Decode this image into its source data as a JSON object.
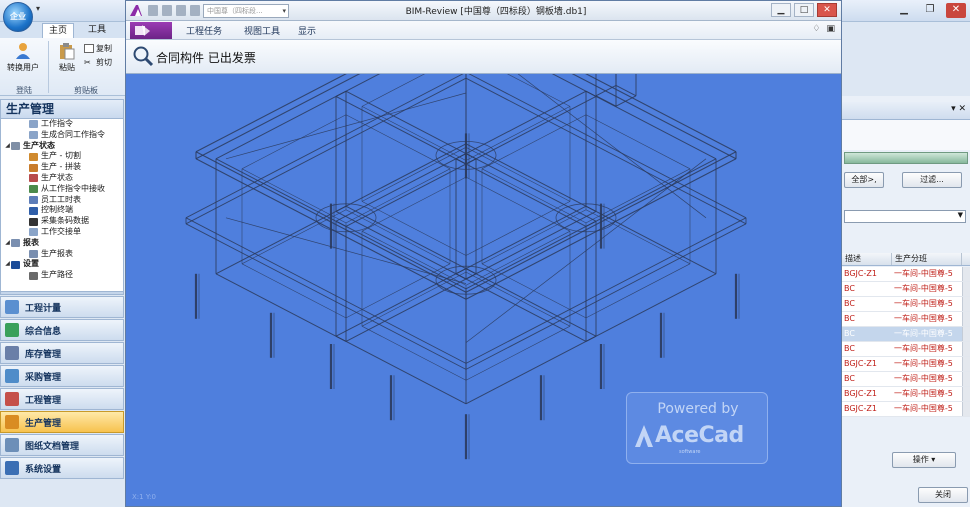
{
  "host": {
    "orb_label": "企业",
    "ribbon_tabs": [
      {
        "label": "主页",
        "active": true
      },
      {
        "label": "工具",
        "active": false
      }
    ],
    "ribbon": {
      "switch_user_label": "转换用户",
      "paste_label": "粘贴",
      "copy_label": "复制",
      "cut_label": "剪切",
      "group_login": "登陆",
      "group_clipboard": "剪贴板"
    },
    "nav_title": "生产管理",
    "tree": [
      {
        "label": "工作指令",
        "level": 2,
        "icon": "document-icon"
      },
      {
        "label": "生成合同工作指令",
        "level": 2,
        "icon": "document-icon"
      },
      {
        "label": "生产状态",
        "level": 1,
        "icon": "gears-icon",
        "category": true
      },
      {
        "label": "生产 - 切割",
        "level": 2,
        "icon": "cut-icon"
      },
      {
        "label": "生产 - 拼装",
        "level": 2,
        "icon": "assemble-icon"
      },
      {
        "label": "生产状态",
        "level": 2,
        "icon": "status-icon"
      },
      {
        "label": "从工作指令中接收",
        "level": 2,
        "icon": "receive-icon"
      },
      {
        "label": "员工工时表",
        "level": 2,
        "icon": "timesheet-icon"
      },
      {
        "label": "控制终端",
        "level": 2,
        "icon": "terminal-icon"
      },
      {
        "label": "采集条码数据",
        "level": 2,
        "icon": "barcode-icon"
      },
      {
        "label": "工作交接单",
        "level": 2,
        "icon": "document-icon"
      },
      {
        "label": "报表",
        "level": 1,
        "icon": "report-icon",
        "category": true
      },
      {
        "label": "生产报表",
        "level": 2,
        "icon": "report-icon"
      },
      {
        "label": "设置",
        "level": 1,
        "icon": "info-icon",
        "category": true
      },
      {
        "label": "生产路径",
        "level": 2,
        "icon": "path-icon"
      }
    ],
    "nav_buttons": [
      {
        "label": "工程计量",
        "active": false,
        "color": "#5a8fd0"
      },
      {
        "label": "综合信息",
        "active": false,
        "color": "#3aa05b"
      },
      {
        "label": "库存管理",
        "active": false,
        "color": "#6a7fa8"
      },
      {
        "label": "采购管理",
        "active": false,
        "color": "#4f8cc9"
      },
      {
        "label": "工程管理",
        "active": false,
        "color": "#c5504a"
      },
      {
        "label": "生产管理",
        "active": true,
        "color": "#d98c22"
      },
      {
        "label": "图纸文档管理",
        "active": false,
        "color": "#6d8fb8"
      },
      {
        "label": "系统设置",
        "active": false,
        "color": "#3b6fb4"
      }
    ],
    "right_panel": {
      "all_button": "全部>,",
      "filter_button": "过滤...",
      "column_desc": "描述",
      "column_team": "生产分班",
      "rows": [
        {
          "desc": "BGJC-Z1",
          "team": "一车间-中国尊-5",
          "selected": false
        },
        {
          "desc": "BC",
          "team": "一车间-中国尊-5",
          "selected": false
        },
        {
          "desc": "BC",
          "team": "一车间-中国尊-5",
          "selected": false
        },
        {
          "desc": "BC",
          "team": "一车间-中国尊-5",
          "selected": false
        },
        {
          "desc": "BC",
          "team": "一车间-中国尊-5",
          "selected": true
        },
        {
          "desc": "BC",
          "team": "一车间-中国尊-5",
          "selected": false
        },
        {
          "desc": "BGJC-Z1",
          "team": "一车间-中国尊-5",
          "selected": false
        },
        {
          "desc": "BC",
          "team": "一车间-中国尊-5",
          "selected": false
        },
        {
          "desc": "BGJC-Z1",
          "team": "一车间-中国尊-5",
          "selected": false
        },
        {
          "desc": "BGJC-Z1",
          "team": "一车间-中国尊-5",
          "selected": false
        }
      ],
      "operate_button": "操作",
      "close_button": "关闭"
    }
  },
  "bim": {
    "title": "BIM-Review [中国尊（四标段）钢板墙.db1]",
    "combo_value": "中国尊（四标段...",
    "menu": [
      "工程任务",
      "视图工具",
      "显示"
    ],
    "toolbar_text": "合同构件 已出发票",
    "coords": "X:1  Y:0",
    "watermark": {
      "powered": "Powered by",
      "brand": "AceCad",
      "sub": "software"
    },
    "colors": {
      "viewport": "#4f7fdd",
      "model_lines": "#2a3a5c",
      "file_tab": "#7e2b9a"
    }
  }
}
